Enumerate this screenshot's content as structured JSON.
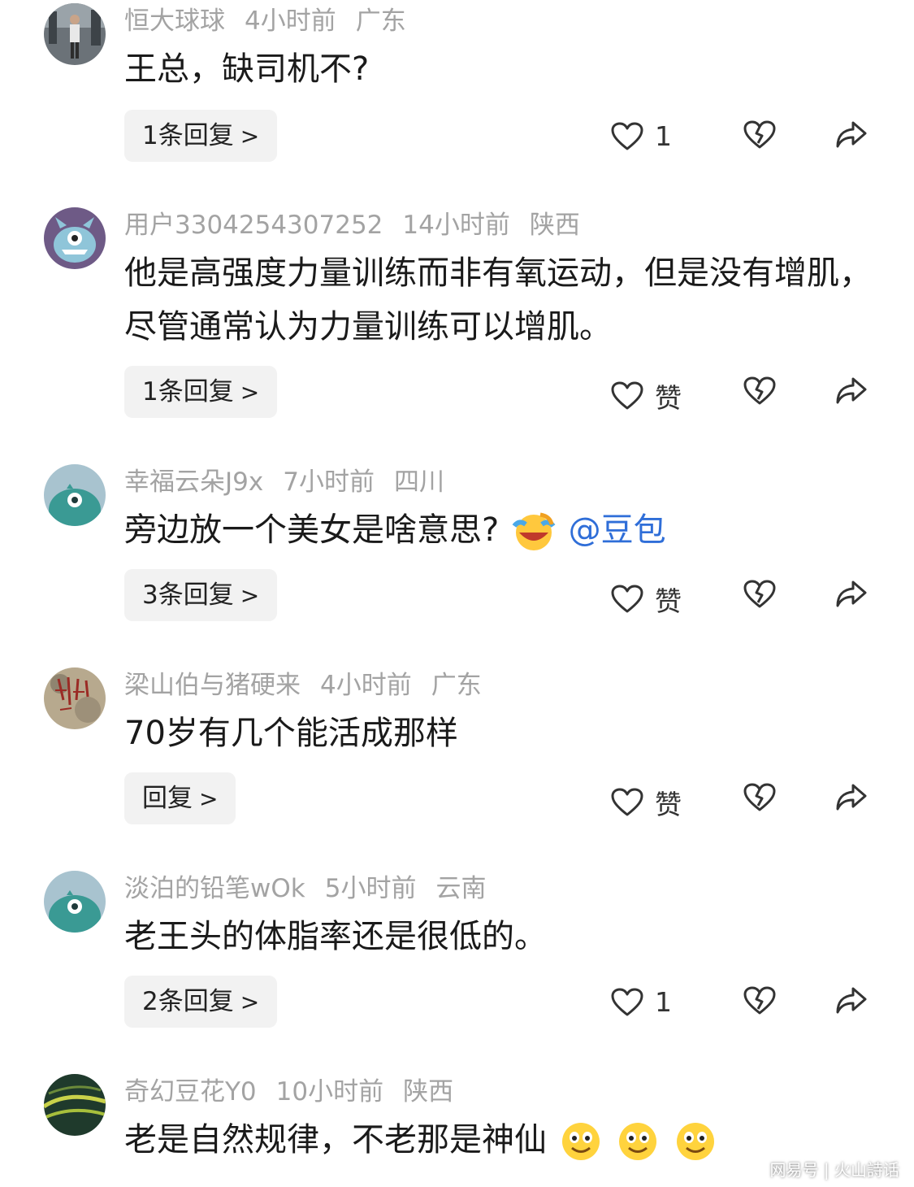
{
  "comments": [
    {
      "user": "恒大球球",
      "time": "4小时前",
      "region": "广东",
      "text": "王总，缺司机不?",
      "reply": "1条回复",
      "likes": "1",
      "avatar": "photo-gym-avatar"
    },
    {
      "user": "用户3304254307252",
      "time": "14小时前",
      "region": "陕西",
      "text": "他是高强度力量训练而非有氧运动，但是没有增肌，尽管通常认为力量训练可以增肌。",
      "reply": "1条回复",
      "likes": "赞",
      "avatar": "purple-monster-avatar"
    },
    {
      "user": "幸福云朵J9x",
      "time": "7小时前",
      "region": "四川",
      "text": "旁边放一个美女是啥意思?",
      "mention": "@豆包",
      "reply": "3条回复",
      "likes": "赞",
      "avatar": "teal-cyclops-avatar"
    },
    {
      "user": "梁山伯与猪硬来",
      "time": "4小时前",
      "region": "广东",
      "text": "70岁有几个能活成那样",
      "reply": "回复",
      "likes": "赞",
      "avatar": "calligraphy-stone-avatar"
    },
    {
      "user": "淡泊的铅笔wOk",
      "time": "5小时前",
      "region": "云南",
      "text": "老王头的体脂率还是很低的。",
      "reply": "2条回复",
      "likes": "1",
      "avatar": "teal-cyclops-avatar"
    },
    {
      "user": "奇幻豆花Y0",
      "time": "10小时前",
      "region": "陕西",
      "text": "老是自然规律，不老那是神仙",
      "reply": "",
      "likes": "",
      "avatar": "dark-green-avatar"
    }
  ],
  "chevron": ">",
  "watermark": "网易号 | 火山詩话",
  "colors": {
    "meta": "#a3a3a3",
    "mention": "#2f6ed8",
    "reply_bg": "#f2f2f2"
  }
}
